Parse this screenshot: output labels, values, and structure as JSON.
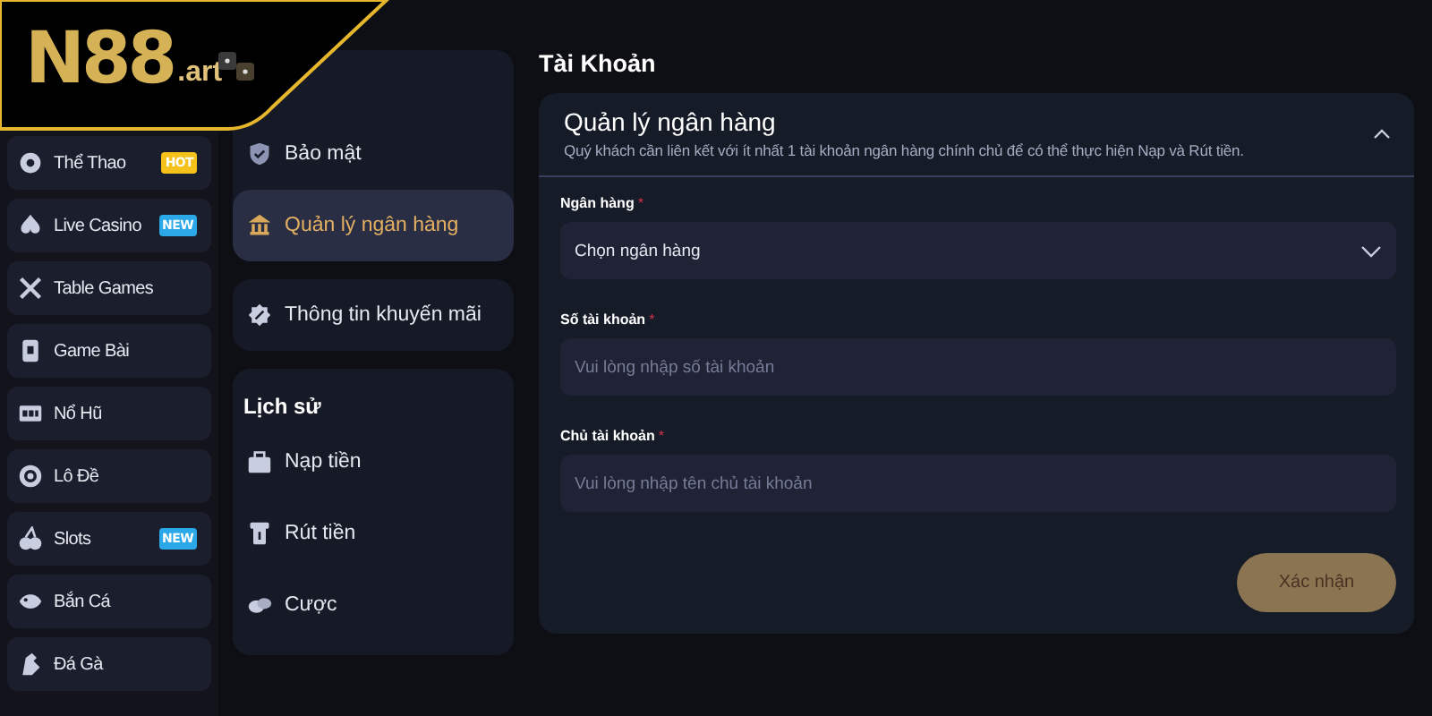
{
  "logo": {
    "brand": "N88",
    "suffix": ".art"
  },
  "sidebar": {
    "items": [
      {
        "label": "Thể Thao",
        "badge": "HOT",
        "color": "#f5c21b"
      },
      {
        "label": "Live Casino",
        "badge": "NEW",
        "color": "#2aa8e8"
      },
      {
        "label": "Table Games"
      },
      {
        "label": "Game Bài"
      },
      {
        "label": "Nổ Hũ"
      },
      {
        "label": "Lô Đề"
      },
      {
        "label": "Slots",
        "badge": "NEW",
        "color": "#2aa8e8"
      },
      {
        "label": "Bắn Cá"
      },
      {
        "label": "Đá Gà"
      }
    ]
  },
  "menu": {
    "groups": [
      {
        "items": [
          {
            "label": "Bảo mật",
            "selected": false
          },
          {
            "label": "Quản lý ngân hàng",
            "selected": true
          }
        ]
      },
      {
        "items": [
          {
            "label": "Thông tin khuyến mãi",
            "selected": false
          }
        ]
      },
      {
        "heading": "Lịch sử",
        "items": [
          {
            "label": "Nạp tiền",
            "selected": false
          },
          {
            "label": "Rút tiền",
            "selected": false
          },
          {
            "label": "Cược",
            "selected": false
          }
        ]
      }
    ]
  },
  "page_title": "Tài Khoản",
  "panel": {
    "title": "Quản lý ngân hàng",
    "subtitle": "Quý khách cần liên kết với ít nhất 1 tài khoản ngân hàng chính chủ để có thể thực hiện Nạp và Rút tiền.",
    "expanded": true,
    "fields": [
      {
        "kind": "select",
        "label": "Ngân hàng",
        "mark": "*",
        "value": "Chọn ngân hàng"
      },
      {
        "kind": "text",
        "label": "Số tài khoản",
        "mark": "*",
        "placeholder": "Vui lòng nhập số tài khoản"
      },
      {
        "kind": "text",
        "label": "Chủ tài khoản",
        "mark": "*",
        "placeholder": "Vui lòng nhập tên chủ tài khoản"
      }
    ],
    "submit": {
      "label": "Xác nhận",
      "disabled": true
    }
  }
}
